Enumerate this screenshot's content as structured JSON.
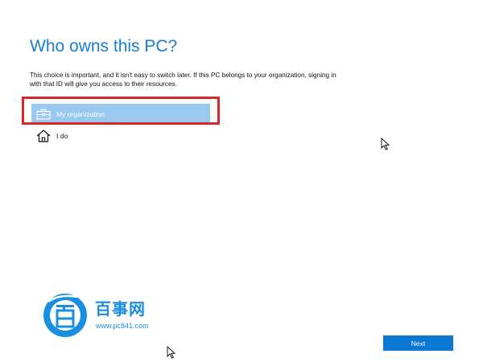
{
  "page": {
    "title": "Who owns this PC?",
    "description": "This choice is important, and it isn't easy to switch later. If this PC belongs to your organization, signing in with that ID will give you access to their resources."
  },
  "options": [
    {
      "label": "My organization",
      "icon": "briefcase-icon",
      "selected": true
    },
    {
      "label": "I do",
      "icon": "home-icon",
      "selected": false
    }
  ],
  "watermark": {
    "name": "百事网",
    "url": "www.pc841.com"
  },
  "footer": {
    "next_label": "Next"
  },
  "colors": {
    "title": "#1a7bd0",
    "selected_option_bg": "#99c9ef",
    "highlight_border": "#d9262b",
    "next_button_bg": "#0a78d4",
    "watermark": "#1a8fe0"
  }
}
